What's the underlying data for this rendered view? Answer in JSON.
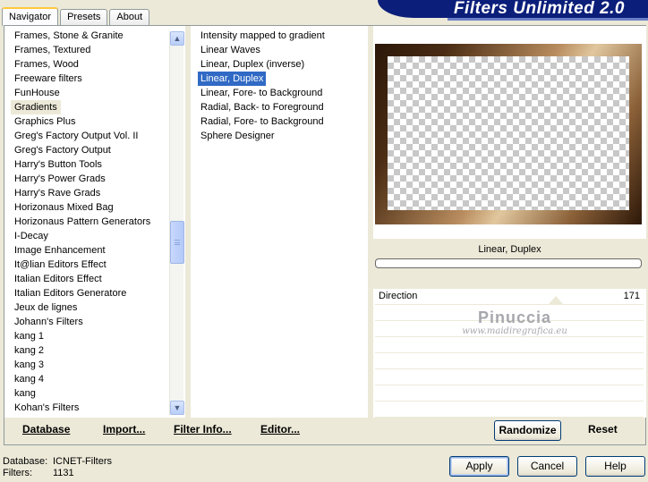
{
  "tabs": [
    {
      "label": "Navigator",
      "active": true
    },
    {
      "label": "Presets",
      "active": false
    },
    {
      "label": "About",
      "active": false
    }
  ],
  "app_title": "Filters Unlimited 2.0",
  "categories": [
    "Frames, Stone & Granite",
    "Frames, Textured",
    "Frames, Wood",
    "Freeware filters",
    "FunHouse",
    "Gradients",
    "Graphics Plus",
    "Greg's Factory Output Vol. II",
    "Greg's Factory Output",
    "Harry's Button Tools",
    "Harry's Power Grads",
    "Harry's Rave Grads",
    "Horizonaus Mixed Bag",
    "Horizonaus Pattern Generators",
    "I-Decay",
    "Image Enhancement",
    "It@lian Editors Effect",
    "Italian Editors Effect",
    "Italian Editors Generatore",
    "Jeux de lignes",
    "Johann's Filters",
    "kang 1",
    "kang 2",
    "kang 3",
    "kang 4",
    "kang",
    "Kohan's Filters"
  ],
  "selected_category": "Gradients",
  "filters": [
    "Intensity mapped to gradient",
    "Linear Waves",
    "Linear, Duplex (inverse)",
    "Linear, Duplex",
    "Linear, Fore- to Background",
    "Radial, Back- to Foreground",
    "Radial, Fore- to Background",
    "Sphere Designer"
  ],
  "selected_filter": "Linear, Duplex",
  "preview": {
    "filter_name": "Linear, Duplex",
    "progress": 0
  },
  "params": {
    "direction_label": "Direction",
    "direction_value": "171",
    "empty_rows": 7
  },
  "watermark": {
    "name": "Pinuccia",
    "url": "www.maidiregrafica.eu"
  },
  "toolbar": {
    "database": "Database",
    "import": "Import...",
    "filter_info": "Filter Info...",
    "editor": "Editor...",
    "randomize": "Randomize",
    "reset": "Reset"
  },
  "status": {
    "database_label": "Database:",
    "database_value": "ICNET-Filters",
    "filters_label": "Filters:",
    "filters_value": "1131"
  },
  "buttons": {
    "apply": "Apply",
    "cancel": "Cancel",
    "help": "Help"
  },
  "icons": {
    "scroll_up": "chevron-up-icon",
    "scroll_down": "chevron-down-icon"
  }
}
